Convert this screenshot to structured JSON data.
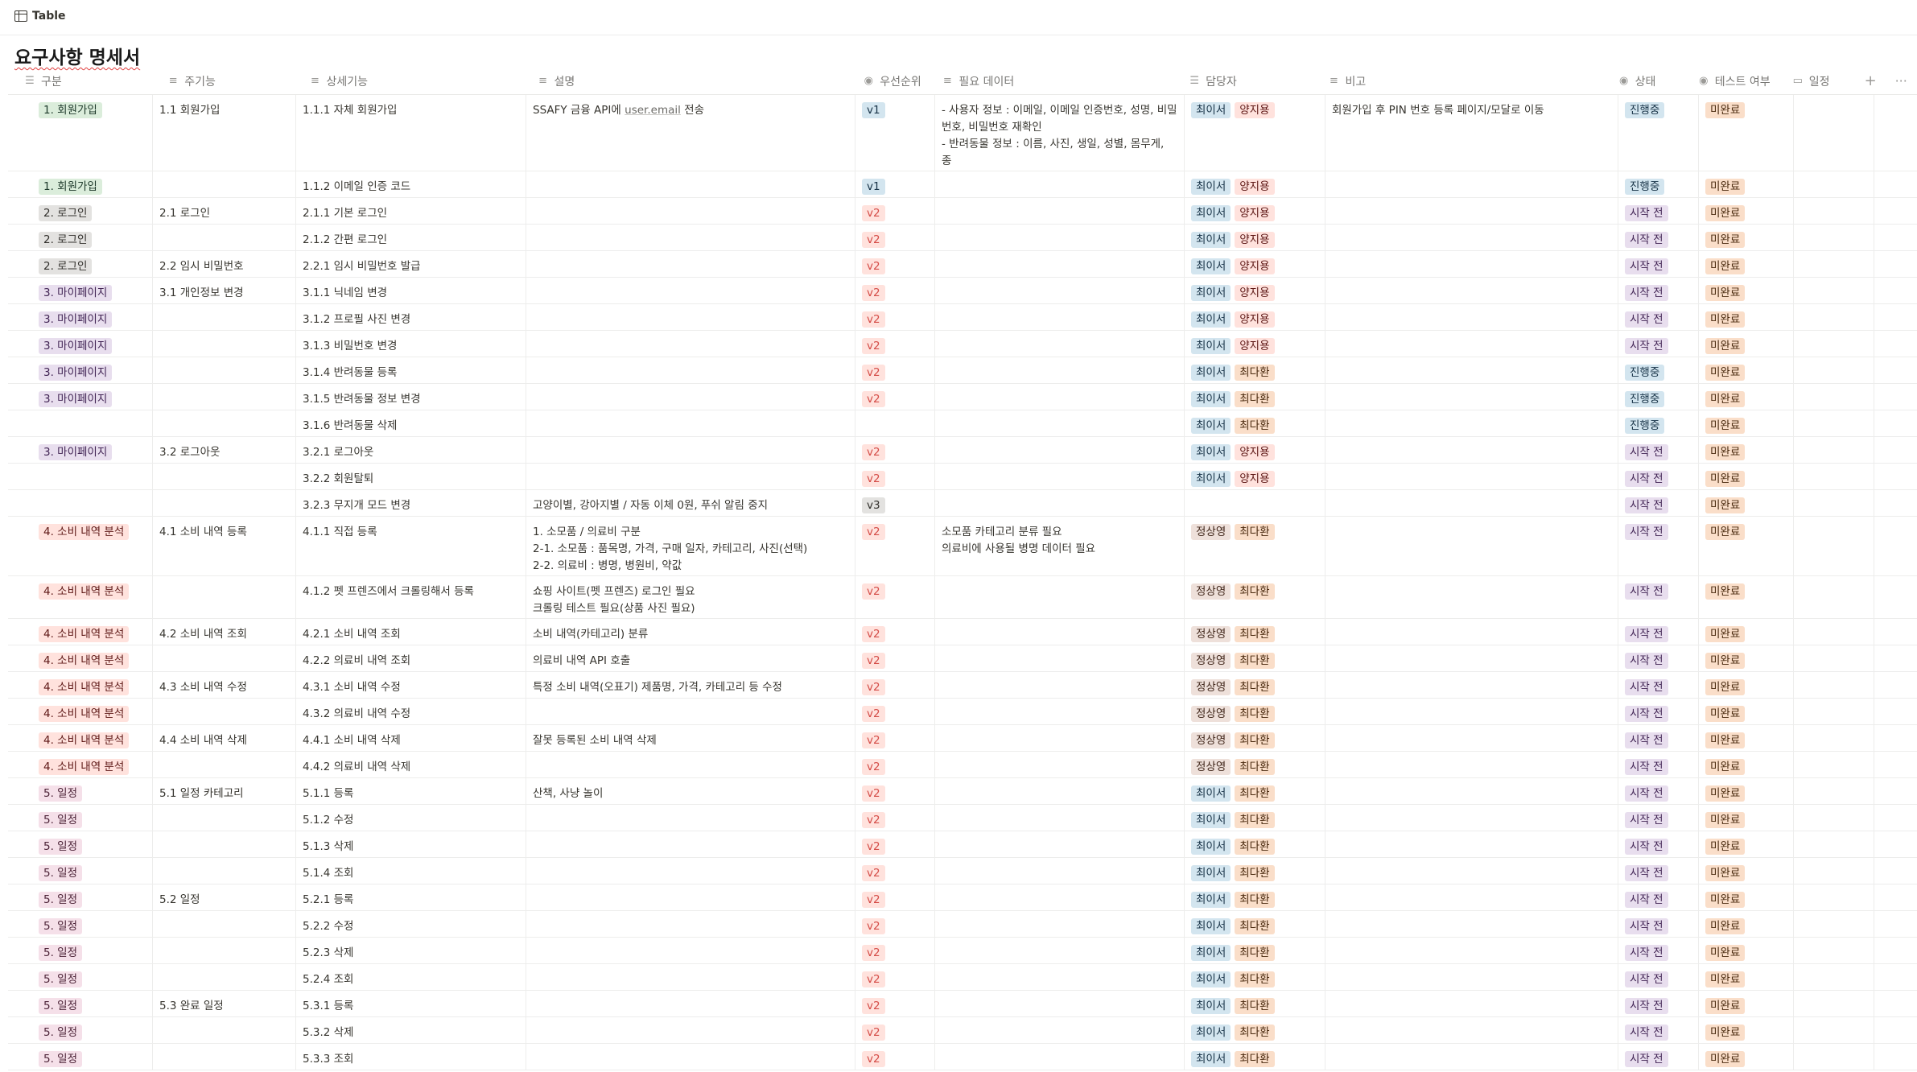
{
  "view": {
    "icon": "table-icon",
    "label": "Table"
  },
  "title": "요구사항 명세서",
  "columns": [
    {
      "key": "c0",
      "label": "구분",
      "icon": "list-icon"
    },
    {
      "key": "c1",
      "label": "주기능",
      "icon": "text-icon"
    },
    {
      "key": "c2",
      "label": "상세기능",
      "icon": "text-icon"
    },
    {
      "key": "c3",
      "label": "설명",
      "icon": "text-icon"
    },
    {
      "key": "c4",
      "label": "우선순위",
      "icon": "status-icon"
    },
    {
      "key": "c5",
      "label": "필요 데이터",
      "icon": "text-icon"
    },
    {
      "key": "c6",
      "label": "담당자",
      "icon": "list-icon"
    },
    {
      "key": "c7",
      "label": "비고",
      "icon": "text-icon"
    },
    {
      "key": "c8",
      "label": "상태",
      "icon": "status-icon"
    },
    {
      "key": "c9",
      "label": "테스트 여부",
      "icon": "status-icon"
    },
    {
      "key": "c10",
      "label": "일정",
      "icon": "comment-icon"
    }
  ],
  "toolbar": {
    "add": "+",
    "more": "···"
  },
  "colors": {
    "green": {
      "bg": "#dbeddb",
      "fg": "#1c3829"
    },
    "gray": {
      "bg": "#e3e2e0",
      "fg": "#32302c"
    },
    "purple": {
      "bg": "#e8deee",
      "fg": "#412454"
    },
    "red": {
      "bg": "#ffe2dd",
      "fg": "#5d1715"
    },
    "pink": {
      "bg": "#f5e0e9",
      "fg": "#4c2337"
    },
    "blue": {
      "bg": "#d3e5ef",
      "fg": "#183347"
    },
    "orange": {
      "bg": "#fadec9",
      "fg": "#49290e"
    },
    "brown": {
      "bg": "#eee0da",
      "fg": "#442a1e"
    },
    "v1": {
      "bg": "#d3e5ef",
      "fg": "#183347"
    },
    "v2": {
      "bg": "#ffe2dd",
      "fg": "#d44c47"
    },
    "v3": {
      "bg": "#e3e2e0",
      "fg": "#32302c"
    }
  },
  "rows": [
    {
      "h": 95,
      "c0": {
        "t": "1. 회원가입",
        "c": "green"
      },
      "c1": "1.1 회원가입",
      "c2": "1.1.1 자체 회원가입",
      "c3": {
        "pre": "SSAFY 금융 API에 ",
        "code": "user.email",
        "post": " 전송"
      },
      "c4": {
        "t": "v1",
        "c": "v1"
      },
      "c5": "- 사용자 정보 : 이메일, 이메일 인증번호, 성명, 비밀번호, 비밀번호 재확인\n- 반려동물 정보 : 이름, 사진, 생일, 성별, 몸무게, 종",
      "c6": [
        {
          "t": "최이서",
          "c": "blue"
        },
        {
          "t": "양지용",
          "c": "red"
        }
      ],
      "c7": "회원가입 후 PIN 번호 등록 페이지/모달로 이동",
      "c8": {
        "t": "진행중",
        "c": "blue"
      },
      "c9": {
        "t": "미완료",
        "c": "orange"
      }
    },
    {
      "h": 33,
      "c0": {
        "t": "1. 회원가입",
        "c": "green"
      },
      "c1": "",
      "c2": "1.1.2 이메일 인증 코드",
      "c3": "",
      "c4": {
        "t": "v1",
        "c": "v1"
      },
      "c5": "",
      "c6": [
        {
          "t": "최이서",
          "c": "blue"
        },
        {
          "t": "양지용",
          "c": "red"
        }
      ],
      "c7": "",
      "c8": {
        "t": "진행중",
        "c": "blue"
      },
      "c9": {
        "t": "미완료",
        "c": "orange"
      }
    },
    {
      "h": 33,
      "c0": {
        "t": "2. 로그인",
        "c": "gray"
      },
      "c1": "2.1 로그인",
      "c2": "2.1.1 기본 로그인",
      "c3": "",
      "c4": {
        "t": "v2",
        "c": "v2"
      },
      "c5": "",
      "c6": [
        {
          "t": "최이서",
          "c": "blue"
        },
        {
          "t": "양지용",
          "c": "red"
        }
      ],
      "c7": "",
      "c8": {
        "t": "시작 전",
        "c": "purple"
      },
      "c9": {
        "t": "미완료",
        "c": "orange"
      }
    },
    {
      "h": 33,
      "c0": {
        "t": "2. 로그인",
        "c": "gray"
      },
      "c1": "",
      "c2": "2.1.2 간편 로그인",
      "c3": "",
      "c4": {
        "t": "v2",
        "c": "v2"
      },
      "c5": "",
      "c6": [
        {
          "t": "최이서",
          "c": "blue"
        },
        {
          "t": "양지용",
          "c": "red"
        }
      ],
      "c7": "",
      "c8": {
        "t": "시작 전",
        "c": "purple"
      },
      "c9": {
        "t": "미완료",
        "c": "orange"
      }
    },
    {
      "h": 33,
      "c0": {
        "t": "2. 로그인",
        "c": "gray"
      },
      "c1": "2.2 임시 비밀번호",
      "c2": "2.2.1 임시 비밀번호 발급",
      "c3": "",
      "c4": {
        "t": "v2",
        "c": "v2"
      },
      "c5": "",
      "c6": [
        {
          "t": "최이서",
          "c": "blue"
        },
        {
          "t": "양지용",
          "c": "red"
        }
      ],
      "c7": "",
      "c8": {
        "t": "시작 전",
        "c": "purple"
      },
      "c9": {
        "t": "미완료",
        "c": "orange"
      }
    },
    {
      "h": 33,
      "c0": {
        "t": "3. 마이페이지",
        "c": "purple"
      },
      "c1": "3.1 개인정보 변경",
      "c2": "3.1.1 닉네임 변경",
      "c3": "",
      "c4": {
        "t": "v2",
        "c": "v2"
      },
      "c5": "",
      "c6": [
        {
          "t": "최이서",
          "c": "blue"
        },
        {
          "t": "양지용",
          "c": "red"
        }
      ],
      "c7": "",
      "c8": {
        "t": "시작 전",
        "c": "purple"
      },
      "c9": {
        "t": "미완료",
        "c": "orange"
      }
    },
    {
      "h": 33,
      "c0": {
        "t": "3. 마이페이지",
        "c": "purple"
      },
      "c1": "",
      "c2": "3.1.2 프로필 사진 변경",
      "c3": "",
      "c4": {
        "t": "v2",
        "c": "v2"
      },
      "c5": "",
      "c6": [
        {
          "t": "최이서",
          "c": "blue"
        },
        {
          "t": "양지용",
          "c": "red"
        }
      ],
      "c7": "",
      "c8": {
        "t": "시작 전",
        "c": "purple"
      },
      "c9": {
        "t": "미완료",
        "c": "orange"
      }
    },
    {
      "h": 33,
      "c0": {
        "t": "3. 마이페이지",
        "c": "purple"
      },
      "c1": "",
      "c2": "3.1.3 비밀번호 변경",
      "c3": "",
      "c4": {
        "t": "v2",
        "c": "v2"
      },
      "c5": "",
      "c6": [
        {
          "t": "최이서",
          "c": "blue"
        },
        {
          "t": "양지용",
          "c": "red"
        }
      ],
      "c7": "",
      "c8": {
        "t": "시작 전",
        "c": "purple"
      },
      "c9": {
        "t": "미완료",
        "c": "orange"
      }
    },
    {
      "h": 33,
      "c0": {
        "t": "3. 마이페이지",
        "c": "purple"
      },
      "c1": "",
      "c2": "3.1.4 반려동물 등록",
      "c3": "",
      "c4": {
        "t": "v2",
        "c": "v2"
      },
      "c5": "",
      "c6": [
        {
          "t": "최이서",
          "c": "blue"
        },
        {
          "t": "최다환",
          "c": "orange"
        }
      ],
      "c7": "",
      "c8": {
        "t": "진행중",
        "c": "blue"
      },
      "c9": {
        "t": "미완료",
        "c": "orange"
      }
    },
    {
      "h": 33,
      "c0": {
        "t": "3. 마이페이지",
        "c": "purple"
      },
      "c1": "",
      "c2": "3.1.5 반려동물 정보 변경",
      "c3": "",
      "c4": {
        "t": "v2",
        "c": "v2"
      },
      "c5": "",
      "c6": [
        {
          "t": "최이서",
          "c": "blue"
        },
        {
          "t": "최다환",
          "c": "orange"
        }
      ],
      "c7": "",
      "c8": {
        "t": "진행중",
        "c": "blue"
      },
      "c9": {
        "t": "미완료",
        "c": "orange"
      }
    },
    {
      "h": 33,
      "c0": null,
      "c1": "",
      "c2": "3.1.6 반려동물 삭제",
      "c3": "",
      "c4": null,
      "c5": "",
      "c6": [
        {
          "t": "최이서",
          "c": "blue"
        },
        {
          "t": "최다환",
          "c": "orange"
        }
      ],
      "c7": "",
      "c8": {
        "t": "진행중",
        "c": "blue"
      },
      "c9": {
        "t": "미완료",
        "c": "orange"
      }
    },
    {
      "h": 33,
      "c0": {
        "t": "3. 마이페이지",
        "c": "purple"
      },
      "c1": "3.2 로그아웃",
      "c2": "3.2.1 로그아웃",
      "c3": "",
      "c4": {
        "t": "v2",
        "c": "v2"
      },
      "c5": "",
      "c6": [
        {
          "t": "최이서",
          "c": "blue"
        },
        {
          "t": "양지용",
          "c": "red"
        }
      ],
      "c7": "",
      "c8": {
        "t": "시작 전",
        "c": "purple"
      },
      "c9": {
        "t": "미완료",
        "c": "orange"
      }
    },
    {
      "h": 33,
      "c0": null,
      "c1": "",
      "c2": "3.2.2 회원탈퇴",
      "c3": "",
      "c4": {
        "t": "v2",
        "c": "v2"
      },
      "c5": "",
      "c6": [
        {
          "t": "최이서",
          "c": "blue"
        },
        {
          "t": "양지용",
          "c": "red"
        }
      ],
      "c7": "",
      "c8": {
        "t": "시작 전",
        "c": "purple"
      },
      "c9": {
        "t": "미완료",
        "c": "orange"
      }
    },
    {
      "h": 33,
      "c0": null,
      "c1": "",
      "c2": "3.2.3 무지개 모드 변경",
      "c3": "고양이별, 강아지별 / 자동 이체 0원, 푸쉬 알림 중지",
      "c4": {
        "t": "v3",
        "c": "v3"
      },
      "c5": "",
      "c6": [],
      "c7": "",
      "c8": {
        "t": "시작 전",
        "c": "purple"
      },
      "c9": {
        "t": "미완료",
        "c": "orange"
      }
    },
    {
      "h": 74,
      "c0": {
        "t": "4. 소비 내역 분석",
        "c": "red"
      },
      "c1": "4.1 소비 내역 등록",
      "c2": "4.1.1 직접 등록",
      "c3": "1. 소모품 / 의료비 구분\n2-1. 소모품 : 품목명, 가격, 구매 일자, 카테고리, 사진(선택)\n2-2. 의료비 : 병명, 병원비, 약값",
      "c4": {
        "t": "v2",
        "c": "v2"
      },
      "c5": "소모품 카테고리 분류 필요\n의료비에 사용될 병명 데이터 필요",
      "c6": [
        {
          "t": "정상영",
          "c": "brown"
        },
        {
          "t": "최다환",
          "c": "orange"
        }
      ],
      "c7": "",
      "c8": {
        "t": "시작 전",
        "c": "purple"
      },
      "c9": {
        "t": "미완료",
        "c": "orange"
      }
    },
    {
      "h": 53,
      "c0": {
        "t": "4. 소비 내역 분석",
        "c": "red"
      },
      "c1": "",
      "c2": "4.1.2 펫 프렌즈에서 크롤링해서 등록",
      "c3": "쇼핑 사이트(펫 프렌즈) 로그인 필요\n크롤링 테스트 필요(상품 사진 필요)",
      "c4": {
        "t": "v2",
        "c": "v2"
      },
      "c5": "",
      "c6": [
        {
          "t": "정상영",
          "c": "brown"
        },
        {
          "t": "최다환",
          "c": "orange"
        }
      ],
      "c7": "",
      "c8": {
        "t": "시작 전",
        "c": "purple"
      },
      "c9": {
        "t": "미완료",
        "c": "orange"
      }
    },
    {
      "h": 33,
      "c0": {
        "t": "4. 소비 내역 분석",
        "c": "red"
      },
      "c1": "4.2 소비 내역 조회",
      "c2": "4.2.1 소비 내역 조회",
      "c3": "소비 내역(카테고리) 분류",
      "c4": {
        "t": "v2",
        "c": "v2"
      },
      "c5": "",
      "c6": [
        {
          "t": "정상영",
          "c": "brown"
        },
        {
          "t": "최다환",
          "c": "orange"
        }
      ],
      "c7": "",
      "c8": {
        "t": "시작 전",
        "c": "purple"
      },
      "c9": {
        "t": "미완료",
        "c": "orange"
      }
    },
    {
      "h": 33,
      "c0": {
        "t": "4. 소비 내역 분석",
        "c": "red"
      },
      "c1": "",
      "c2": "4.2.2 의료비 내역 조회",
      "c3": "의료비 내역 API 호출",
      "c4": {
        "t": "v2",
        "c": "v2"
      },
      "c5": "",
      "c6": [
        {
          "t": "정상영",
          "c": "brown"
        },
        {
          "t": "최다환",
          "c": "orange"
        }
      ],
      "c7": "",
      "c8": {
        "t": "시작 전",
        "c": "purple"
      },
      "c9": {
        "t": "미완료",
        "c": "orange"
      }
    },
    {
      "h": 33,
      "c0": {
        "t": "4. 소비 내역 분석",
        "c": "red"
      },
      "c1": "4.3 소비 내역 수정",
      "c2": "4.3.1 소비 내역 수정",
      "c3": "특정 소비 내역(오표기) 제품명, 가격, 카테고리 등 수정",
      "c4": {
        "t": "v2",
        "c": "v2"
      },
      "c5": "",
      "c6": [
        {
          "t": "정상영",
          "c": "brown"
        },
        {
          "t": "최다환",
          "c": "orange"
        }
      ],
      "c7": "",
      "c8": {
        "t": "시작 전",
        "c": "purple"
      },
      "c9": {
        "t": "미완료",
        "c": "orange"
      }
    },
    {
      "h": 33,
      "c0": {
        "t": "4. 소비 내역 분석",
        "c": "red"
      },
      "c1": "",
      "c2": "4.3.2 의료비 내역 수정",
      "c3": "",
      "c4": {
        "t": "v2",
        "c": "v2"
      },
      "c5": "",
      "c6": [
        {
          "t": "정상영",
          "c": "brown"
        },
        {
          "t": "최다환",
          "c": "orange"
        }
      ],
      "c7": "",
      "c8": {
        "t": "시작 전",
        "c": "purple"
      },
      "c9": {
        "t": "미완료",
        "c": "orange"
      }
    },
    {
      "h": 33,
      "c0": {
        "t": "4. 소비 내역 분석",
        "c": "red"
      },
      "c1": "4.4 소비 내역 삭제",
      "c2": "4.4.1 소비 내역 삭제",
      "c3": "잘못 등록된 소비 내역 삭제",
      "c4": {
        "t": "v2",
        "c": "v2"
      },
      "c5": "",
      "c6": [
        {
          "t": "정상영",
          "c": "brown"
        },
        {
          "t": "최다환",
          "c": "orange"
        }
      ],
      "c7": "",
      "c8": {
        "t": "시작 전",
        "c": "purple"
      },
      "c9": {
        "t": "미완료",
        "c": "orange"
      }
    },
    {
      "h": 33,
      "c0": {
        "t": "4. 소비 내역 분석",
        "c": "red"
      },
      "c1": "",
      "c2": "4.4.2 의료비 내역 삭제",
      "c3": "",
      "c4": {
        "t": "v2",
        "c": "v2"
      },
      "c5": "",
      "c6": [
        {
          "t": "정상영",
          "c": "brown"
        },
        {
          "t": "최다환",
          "c": "orange"
        }
      ],
      "c7": "",
      "c8": {
        "t": "시작 전",
        "c": "purple"
      },
      "c9": {
        "t": "미완료",
        "c": "orange"
      }
    },
    {
      "h": 33,
      "c0": {
        "t": "5. 일정",
        "c": "pink"
      },
      "c1": "5.1 일정 카테고리",
      "c2": "5.1.1 등록",
      "c3": "산책, 사냥 놀이",
      "c4": {
        "t": "v2",
        "c": "v2"
      },
      "c5": "",
      "c6": [
        {
          "t": "최이서",
          "c": "blue"
        },
        {
          "t": "최다환",
          "c": "orange"
        }
      ],
      "c7": "",
      "c8": {
        "t": "시작 전",
        "c": "purple"
      },
      "c9": {
        "t": "미완료",
        "c": "orange"
      }
    },
    {
      "h": 33,
      "c0": {
        "t": "5. 일정",
        "c": "pink"
      },
      "c1": "",
      "c2": "5.1.2 수정",
      "c3": "",
      "c4": {
        "t": "v2",
        "c": "v2"
      },
      "c5": "",
      "c6": [
        {
          "t": "최이서",
          "c": "blue"
        },
        {
          "t": "최다환",
          "c": "orange"
        }
      ],
      "c7": "",
      "c8": {
        "t": "시작 전",
        "c": "purple"
      },
      "c9": {
        "t": "미완료",
        "c": "orange"
      }
    },
    {
      "h": 33,
      "c0": {
        "t": "5. 일정",
        "c": "pink"
      },
      "c1": "",
      "c2": "5.1.3 삭제",
      "c3": "",
      "c4": {
        "t": "v2",
        "c": "v2"
      },
      "c5": "",
      "c6": [
        {
          "t": "최이서",
          "c": "blue"
        },
        {
          "t": "최다환",
          "c": "orange"
        }
      ],
      "c7": "",
      "c8": {
        "t": "시작 전",
        "c": "purple"
      },
      "c9": {
        "t": "미완료",
        "c": "orange"
      }
    },
    {
      "h": 33,
      "c0": {
        "t": "5. 일정",
        "c": "pink"
      },
      "c1": "",
      "c2": "5.1.4 조회",
      "c3": "",
      "c4": {
        "t": "v2",
        "c": "v2"
      },
      "c5": "",
      "c6": [
        {
          "t": "최이서",
          "c": "blue"
        },
        {
          "t": "최다환",
          "c": "orange"
        }
      ],
      "c7": "",
      "c8": {
        "t": "시작 전",
        "c": "purple"
      },
      "c9": {
        "t": "미완료",
        "c": "orange"
      }
    },
    {
      "h": 33,
      "c0": {
        "t": "5. 일정",
        "c": "pink"
      },
      "c1": "5.2 일정",
      "c2": "5.2.1 등록",
      "c3": "",
      "c4": {
        "t": "v2",
        "c": "v2"
      },
      "c5": "",
      "c6": [
        {
          "t": "최이서",
          "c": "blue"
        },
        {
          "t": "최다환",
          "c": "orange"
        }
      ],
      "c7": "",
      "c8": {
        "t": "시작 전",
        "c": "purple"
      },
      "c9": {
        "t": "미완료",
        "c": "orange"
      }
    },
    {
      "h": 33,
      "c0": {
        "t": "5. 일정",
        "c": "pink"
      },
      "c1": "",
      "c2": "5.2.2 수정",
      "c3": "",
      "c4": {
        "t": "v2",
        "c": "v2"
      },
      "c5": "",
      "c6": [
        {
          "t": "최이서",
          "c": "blue"
        },
        {
          "t": "최다환",
          "c": "orange"
        }
      ],
      "c7": "",
      "c8": {
        "t": "시작 전",
        "c": "purple"
      },
      "c9": {
        "t": "미완료",
        "c": "orange"
      }
    },
    {
      "h": 33,
      "c0": {
        "t": "5. 일정",
        "c": "pink"
      },
      "c1": "",
      "c2": "5.2.3 삭제",
      "c3": "",
      "c4": {
        "t": "v2",
        "c": "v2"
      },
      "c5": "",
      "c6": [
        {
          "t": "최이서",
          "c": "blue"
        },
        {
          "t": "최다환",
          "c": "orange"
        }
      ],
      "c7": "",
      "c8": {
        "t": "시작 전",
        "c": "purple"
      },
      "c9": {
        "t": "미완료",
        "c": "orange"
      }
    },
    {
      "h": 33,
      "c0": {
        "t": "5. 일정",
        "c": "pink"
      },
      "c1": "",
      "c2": "5.2.4 조회",
      "c3": "",
      "c4": {
        "t": "v2",
        "c": "v2"
      },
      "c5": "",
      "c6": [
        {
          "t": "최이서",
          "c": "blue"
        },
        {
          "t": "최다환",
          "c": "orange"
        }
      ],
      "c7": "",
      "c8": {
        "t": "시작 전",
        "c": "purple"
      },
      "c9": {
        "t": "미완료",
        "c": "orange"
      }
    },
    {
      "h": 33,
      "c0": {
        "t": "5. 일정",
        "c": "pink"
      },
      "c1": "5.3 완료 일정",
      "c2": "5.3.1 등록",
      "c3": "",
      "c4": {
        "t": "v2",
        "c": "v2"
      },
      "c5": "",
      "c6": [
        {
          "t": "최이서",
          "c": "blue"
        },
        {
          "t": "최다환",
          "c": "orange"
        }
      ],
      "c7": "",
      "c8": {
        "t": "시작 전",
        "c": "purple"
      },
      "c9": {
        "t": "미완료",
        "c": "orange"
      }
    },
    {
      "h": 33,
      "c0": {
        "t": "5. 일정",
        "c": "pink"
      },
      "c1": "",
      "c2": "5.3.2 삭제",
      "c3": "",
      "c4": {
        "t": "v2",
        "c": "v2"
      },
      "c5": "",
      "c6": [
        {
          "t": "최이서",
          "c": "blue"
        },
        {
          "t": "최다환",
          "c": "orange"
        }
      ],
      "c7": "",
      "c8": {
        "t": "시작 전",
        "c": "purple"
      },
      "c9": {
        "t": "미완료",
        "c": "orange"
      }
    },
    {
      "h": 33,
      "c0": {
        "t": "5. 일정",
        "c": "pink"
      },
      "c1": "",
      "c2": "5.3.3 조회",
      "c3": "",
      "c4": {
        "t": "v2",
        "c": "v2"
      },
      "c5": "",
      "c6": [
        {
          "t": "최이서",
          "c": "blue"
        },
        {
          "t": "최다환",
          "c": "orange"
        }
      ],
      "c7": "",
      "c8": {
        "t": "시작 전",
        "c": "purple"
      },
      "c9": {
        "t": "미완료",
        "c": "orange"
      }
    }
  ]
}
